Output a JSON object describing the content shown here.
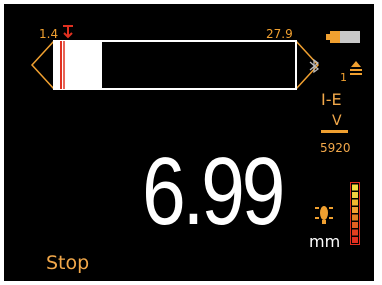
{
  "gauge": {
    "range_min": "1.4",
    "range_max": "27.9",
    "reading_fraction": 0.049
  },
  "measurement": {
    "value": "6.99",
    "unit": "mm"
  },
  "settings": {
    "mode": "I-E",
    "velocity_label": "V",
    "velocity_value": "5920",
    "probe_number": "1"
  },
  "status": "Stop",
  "signal_strength_bars": 8,
  "colors": {
    "accent": "#f0a030",
    "text_white": "#ffffff",
    "marker_red": "#e03020",
    "background": "#000000"
  },
  "icons": {
    "battery": "battery-icon",
    "bluetooth": "bluetooth-icon",
    "probe": "probe-icon",
    "coupling": "coupling-icon",
    "signal": "signal-strength-icon",
    "min_marker": "min-threshold-marker-icon"
  }
}
